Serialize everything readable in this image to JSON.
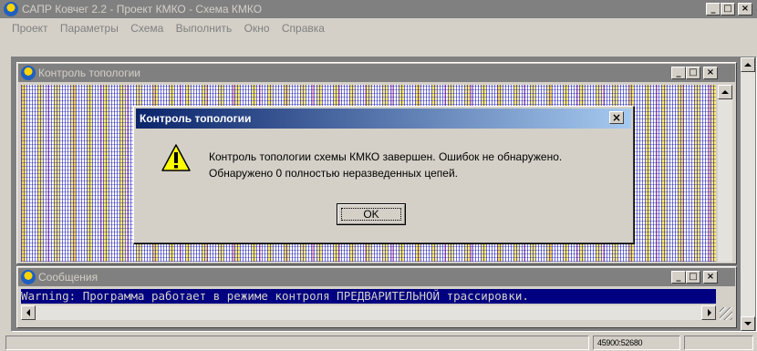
{
  "app": {
    "title": "САПР Ковчег 2.2 - Проект КМКО - Схема КМКО",
    "controls": {
      "minimize": "_",
      "maximize": "□",
      "close": "×"
    }
  },
  "menu": [
    "Проект",
    "Параметры",
    "Схема",
    "Выполнить",
    "Окно",
    "Справка"
  ],
  "topology_window": {
    "title": "Контроль топологии"
  },
  "dialog": {
    "title": "Контроль топологии",
    "close": "×",
    "icon": "warning-icon",
    "message_line1": "Контроль топологии схемы КМКО завершен. Ошибок не обнаружено.",
    "message_line2": "Обнаружено 0 полностью неразведенных цепей.",
    "ok_label": "OK"
  },
  "messages_window": {
    "title": "Сообщения",
    "line": "Warning: Программа работает в режиме контроля ПРЕДВАРИТЕЛЬНОЙ трассировки."
  },
  "statusbar": {
    "coordinates": "45900:52680"
  },
  "colors": {
    "active_title_start": "#0a246a",
    "active_title_end": "#a6caf0",
    "inactive_title": "#808080",
    "message_bg": "#000080"
  }
}
